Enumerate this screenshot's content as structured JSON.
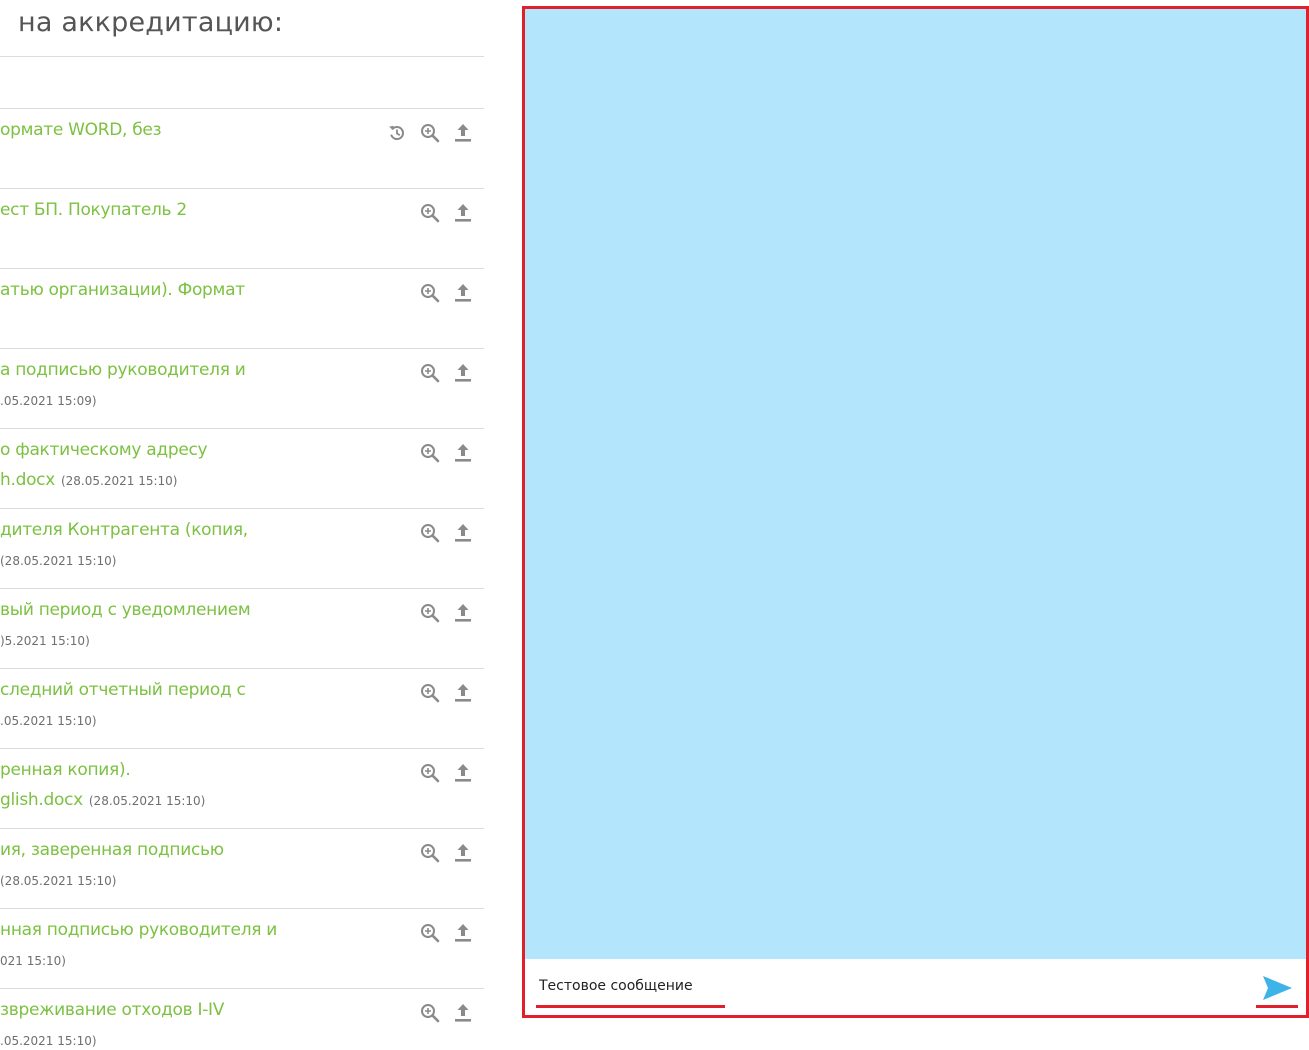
{
  "panel": {
    "title": "на аккредитацию:"
  },
  "documents": [
    {
      "title": "ормате WORD, без",
      "file": "",
      "date": "",
      "icons": [
        "history-icon",
        "zoom-in-icon",
        "upload-icon"
      ]
    },
    {
      "title": "ест БП. Покупатель 2",
      "file": "",
      "date": "",
      "icons": [
        "zoom-in-icon",
        "upload-icon"
      ]
    },
    {
      "title": "атью организации). Формат",
      "file": "",
      "date": "",
      "icons": [
        "zoom-in-icon",
        "upload-icon"
      ]
    },
    {
      "title": "а подписью руководителя и",
      "file": "",
      "date": ".05.2021 15:09)",
      "icons": [
        "zoom-in-icon",
        "upload-icon"
      ]
    },
    {
      "title": "о фактическому адресу",
      "file": "h.docx",
      "date": "(28.05.2021 15:10)",
      "icons": [
        "zoom-in-icon",
        "upload-icon"
      ]
    },
    {
      "title": "дителя Контрагента (копия,",
      "file": "",
      "date": "(28.05.2021 15:10)",
      "icons": [
        "zoom-in-icon",
        "upload-icon"
      ]
    },
    {
      "title": "вый период с уведомлением",
      "file": "",
      "date": ")5.2021 15:10)",
      "icons": [
        "zoom-in-icon",
        "upload-icon"
      ]
    },
    {
      "title": "следний отчетный период с",
      "file": "",
      "date": ".05.2021 15:10)",
      "icons": [
        "zoom-in-icon",
        "upload-icon"
      ]
    },
    {
      "title": "ренная копия).",
      "file": "glish.docx",
      "date": "(28.05.2021 15:10)",
      "icons": [
        "zoom-in-icon",
        "upload-icon"
      ]
    },
    {
      "title": "ия, заверенная подписью",
      "file": "",
      "date": "(28.05.2021 15:10)",
      "icons": [
        "zoom-in-icon",
        "upload-icon"
      ]
    },
    {
      "title": "нная подписью руководителя и",
      "file": "",
      "date": "021 15:10)",
      "icons": [
        "zoom-in-icon",
        "upload-icon"
      ]
    },
    {
      "title": "звреживание отходов I-IV",
      "file": "",
      "date": ".05.2021 15:10)",
      "icons": [
        "zoom-in-icon",
        "upload-icon"
      ]
    }
  ],
  "chat": {
    "message_input_value": "Тестовое сообщение",
    "send_icon": "send-icon"
  },
  "colors": {
    "link_green": "#7cc141",
    "icon_gray": "#8a8a8a",
    "chat_background": "#b3e5fc",
    "highlight_red": "#e0202b",
    "send_blue": "#3eb3e8"
  }
}
